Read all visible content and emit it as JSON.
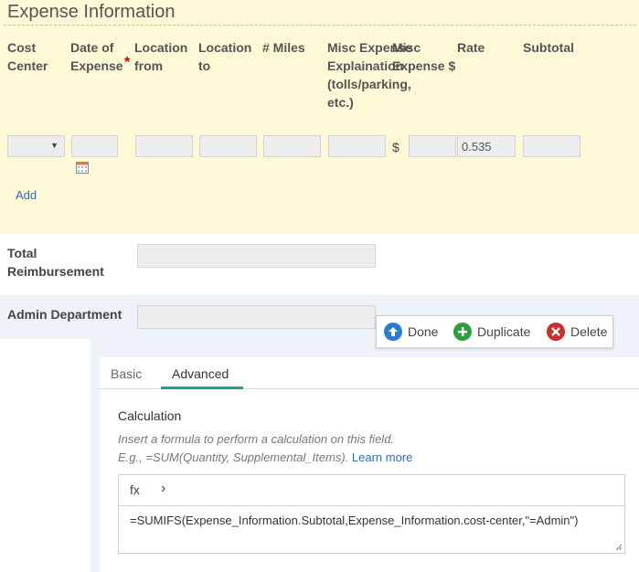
{
  "expense": {
    "title": "Expense Information",
    "columns": [
      "Cost Center",
      "Date of Expense",
      "Location from",
      "Location to",
      "# Miles",
      "Misc Expense Explaination (tolls/parking, etc.)",
      "Misc Expense $",
      "Rate",
      "Subtotal"
    ],
    "required_mark": "*",
    "dollar_sign": "$",
    "rate_value": "0.535",
    "add_label": "Add"
  },
  "total": {
    "label": "Total Reimbursement"
  },
  "admin": {
    "label": "Admin Department"
  },
  "toolbar": {
    "done_label": "Done",
    "duplicate_label": "Duplicate",
    "delete_label": "Delete"
  },
  "tabs": {
    "basic": "Basic",
    "advanced": "Advanced"
  },
  "calculation": {
    "title": "Calculation",
    "help_line1": "Insert a formula to perform a calculation on this field.",
    "help_line2": "E.g., =SUM(Quantity, Supplemental_Items).",
    "learn_more": "Learn more",
    "fx_label": "fx",
    "chevron": "›",
    "formula": "=SUMIFS(Expense_Information.Subtotal,Expense_Information.cost-center,\"=Admin\")"
  },
  "colors": {
    "expense_bg": "#fdf8d6",
    "admin_bg": "#eef3f9",
    "accent_tab": "#17a58c",
    "link": "#2a6ebb",
    "done_icon": "#2a7bd1",
    "duplicate_icon": "#2e9e3e",
    "delete_icon": "#c9302c"
  }
}
